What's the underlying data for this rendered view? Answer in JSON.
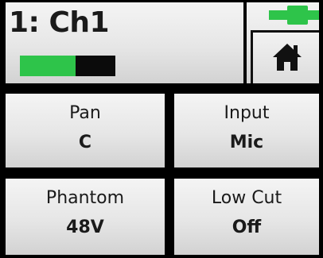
{
  "header": {
    "channel_title": "1: Ch1",
    "level_meter": {
      "level": 0.58,
      "color": "#2ec44a"
    },
    "fader": {
      "position": 0.62,
      "color": "#2ec44a"
    }
  },
  "home_button": {
    "icon": "home-icon"
  },
  "parameters": [
    {
      "id": "pan",
      "label": "Pan",
      "value": "C"
    },
    {
      "id": "input",
      "label": "Input",
      "value": "Mic"
    },
    {
      "id": "phantom",
      "label": "Phantom",
      "value": "48V"
    },
    {
      "id": "low_cut",
      "label": "Low Cut",
      "value": "Off"
    }
  ],
  "colors": {
    "accent_green": "#2ec44a",
    "background": "#000000",
    "panel": "#e6e6e6",
    "text": "#1a1a1a"
  }
}
